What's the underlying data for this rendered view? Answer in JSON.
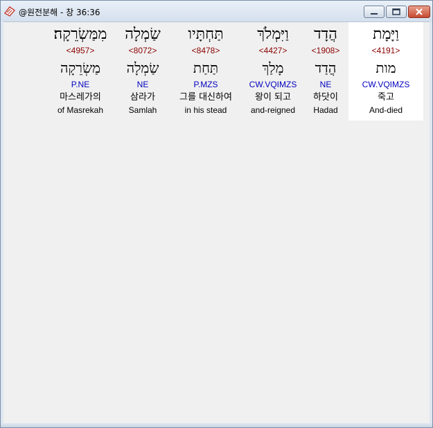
{
  "window": {
    "title": "@원전분해 - 창 36:36",
    "icon": "bible-app-icon",
    "controls": [
      "minimize-icon",
      "maximize-icon",
      "close-icon"
    ]
  },
  "words": [
    {
      "hebrew": "וַיָּמָת",
      "strong": "<4191>",
      "lexeme": "מות",
      "morph": "CW.VQIMZS",
      "korean": "죽고",
      "english": "And-died",
      "selected": true
    },
    {
      "hebrew": "הֲדָד",
      "strong": "<1908>",
      "lexeme": "הֲדַד",
      "morph": "NE",
      "korean": "하닷이",
      "english": "Hadad",
      "selected": false
    },
    {
      "hebrew": "וַיִּמְלֹךְ",
      "strong": "<4427>",
      "lexeme": "מָלַךְ",
      "morph": "CW.VQIMZS",
      "korean": "왕이 되고",
      "english": "and-reigned",
      "selected": false
    },
    {
      "hebrew": "תַּחְתָּיו",
      "strong": "<8478>",
      "lexeme": "תַּחַת",
      "morph": "P.MZS",
      "korean": "그를 대신하여",
      "english": "in his stead",
      "selected": false
    },
    {
      "hebrew": "שַׂמְלָה",
      "strong": "<8072>",
      "lexeme": "שַׂמְלָה",
      "morph": "NE",
      "korean": "삼라가",
      "english": "Samlah",
      "selected": false
    },
    {
      "hebrew": "מִמַּשְׂרֵקָה׃",
      "strong": "<4957>",
      "lexeme": "מַשְׂרֵקָה",
      "morph": "P.NE",
      "korean": "마스레가의",
      "english": "of Masrekah",
      "selected": false
    }
  ]
}
